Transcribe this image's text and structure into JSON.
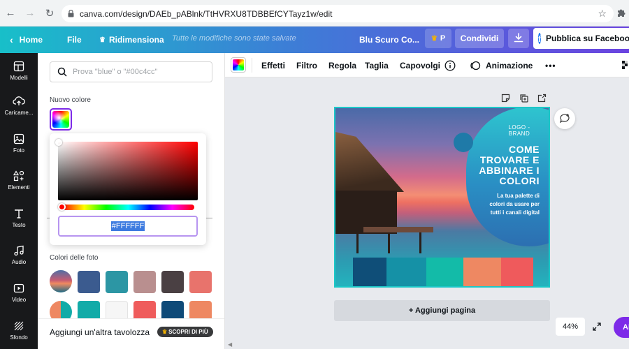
{
  "browser": {
    "url": "canva.com/design/DAEb_pABlnk/TtHVRXU8TDBBEfCYTayz1w/edit"
  },
  "topbar": {
    "home": "Home",
    "file": "File",
    "resize": "Ridimensiona",
    "saved_status": "Tutte le modifiche sono state salvate",
    "doc_title": "Blu Scuro Co...",
    "pro_label": "P",
    "share": "Condividi",
    "publish": "Pubblica su Facebook"
  },
  "rail": {
    "items": [
      {
        "label": "Modelli"
      },
      {
        "label": "Caricame..."
      },
      {
        "label": "Foto"
      },
      {
        "label": "Elementi"
      },
      {
        "label": "Testo"
      },
      {
        "label": "Audio"
      },
      {
        "label": "Video"
      },
      {
        "label": "Sfondo"
      }
    ]
  },
  "panel": {
    "search_placeholder": "Prova \"blue\" o \"#00c4cc\"",
    "new_color_label": "Nuovo colore",
    "hex_value": "#FFFFFF",
    "photo_colors_label": "Colori delle foto",
    "swatches_row1": [
      "#3b5b8f",
      "#2c96a4",
      "#b98f8f",
      "#4a4043",
      "#e8736c"
    ],
    "swatches_row2": [
      "#12aba8",
      "#f6f6f6",
      "#ef5c5c",
      "#0f4a78",
      "#ee8862"
    ],
    "more_boards": "Aggiungi un'altra tavolozza",
    "discover": "SCOPRI DI PIÙ"
  },
  "toolbar": {
    "effects": "Effetti",
    "filter": "Filtro",
    "adjust": "Regola",
    "crop": "Taglia",
    "flip": "Capovolgi",
    "animate": "Animazione",
    "more": "•••"
  },
  "design": {
    "logo": "LOGO -\nBRAND",
    "headline": "COME TROVARE E ABBINARE I COLORI",
    "subline": "La tua palette di colori da usare per tutti i canali digital",
    "strip_colors": [
      "#0f4e78",
      "#1591a6",
      "#13bba8",
      "#ee8862",
      "#ef5a5c"
    ]
  },
  "canvas": {
    "add_page": "+ Aggiungi pagina",
    "zoom": "44%",
    "help": "Ai"
  },
  "colors": {
    "accent": "#7d2ae8",
    "rail_bg": "#18191b",
    "selection": "#1bc7c7"
  }
}
